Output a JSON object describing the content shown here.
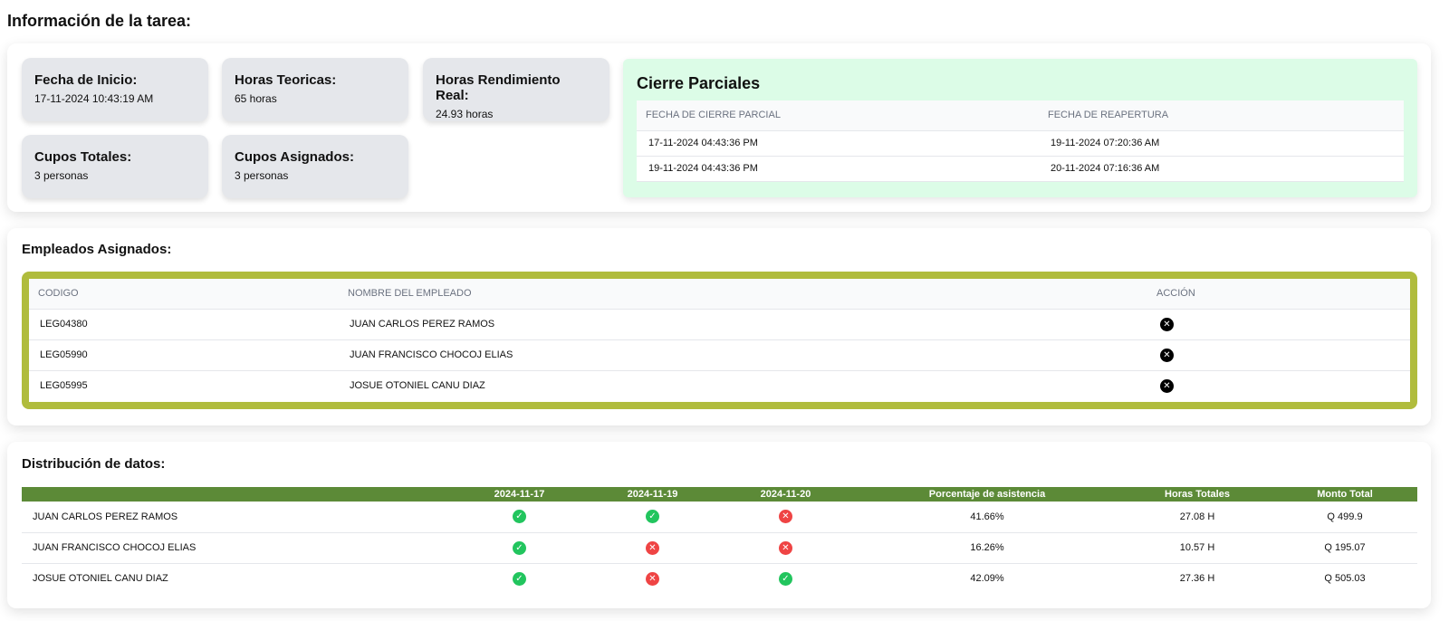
{
  "page_title": "Información de la tarea:",
  "cards": [
    {
      "label": "Fecha de Inicio:",
      "value": "17-11-2024 10:43:19 AM"
    },
    {
      "label": "Horas Teoricas:",
      "value": "65 horas"
    },
    {
      "label": "Horas Rendimiento Real:",
      "value": "24.93 horas"
    },
    {
      "label": "Cupos Totales:",
      "value": "3 personas"
    },
    {
      "label": "Cupos Asignados:",
      "value": "3 personas"
    }
  ],
  "cierre": {
    "title": "Cierre Parciales",
    "headers": [
      "FECHA DE CIERRE PARCIAL",
      "FECHA DE REAPERTURA"
    ],
    "rows": [
      [
        "17-11-2024 04:43:36 PM",
        "19-11-2024 07:20:36 AM"
      ],
      [
        "19-11-2024 04:43:36 PM",
        "20-11-2024 07:16:36 AM"
      ]
    ]
  },
  "empleados": {
    "title": "Empleados Asignados:",
    "headers": [
      "CODIGO",
      "NOMBRE DEL EMPLEADO",
      "ACCIÓN"
    ],
    "rows": [
      {
        "codigo": "LEG04380",
        "nombre": "JUAN CARLOS PEREZ RAMOS"
      },
      {
        "codigo": "LEG05990",
        "nombre": "JUAN FRANCISCO CHOCOJ ELIAS"
      },
      {
        "codigo": "LEG05995",
        "nombre": "JOSUE OTONIEL CANU DIAZ"
      }
    ],
    "action_icon": "remove-circle-icon"
  },
  "distribucion": {
    "title": "Distribución de datos:",
    "headers": [
      "",
      "2024-11-17",
      "2024-11-19",
      "2024-11-20",
      "Porcentaje de asistencia",
      "Horas Totales",
      "Monto Total"
    ],
    "rows": [
      {
        "nombre": "JUAN CARLOS PEREZ RAMOS",
        "asistencia": [
          true,
          true,
          false
        ],
        "porcentaje": "41.66%",
        "horas": "27.08 H",
        "monto": "Q 499.9"
      },
      {
        "nombre": "JUAN FRANCISCO CHOCOJ ELIAS",
        "asistencia": [
          true,
          false,
          false
        ],
        "porcentaje": "16.26%",
        "horas": "10.57 H",
        "monto": "Q 195.07"
      },
      {
        "nombre": "JOSUE OTONIEL CANU DIAZ",
        "asistencia": [
          true,
          false,
          true
        ],
        "porcentaje": "42.09%",
        "horas": "27.36 H",
        "monto": "Q 505.03"
      }
    ]
  },
  "colors": {
    "cierre_bg": "#dcfce7",
    "emp_border": "#b0bc3d",
    "dist_header": "#5c8a37",
    "present": "#22c55e",
    "absent": "#ef4444"
  }
}
